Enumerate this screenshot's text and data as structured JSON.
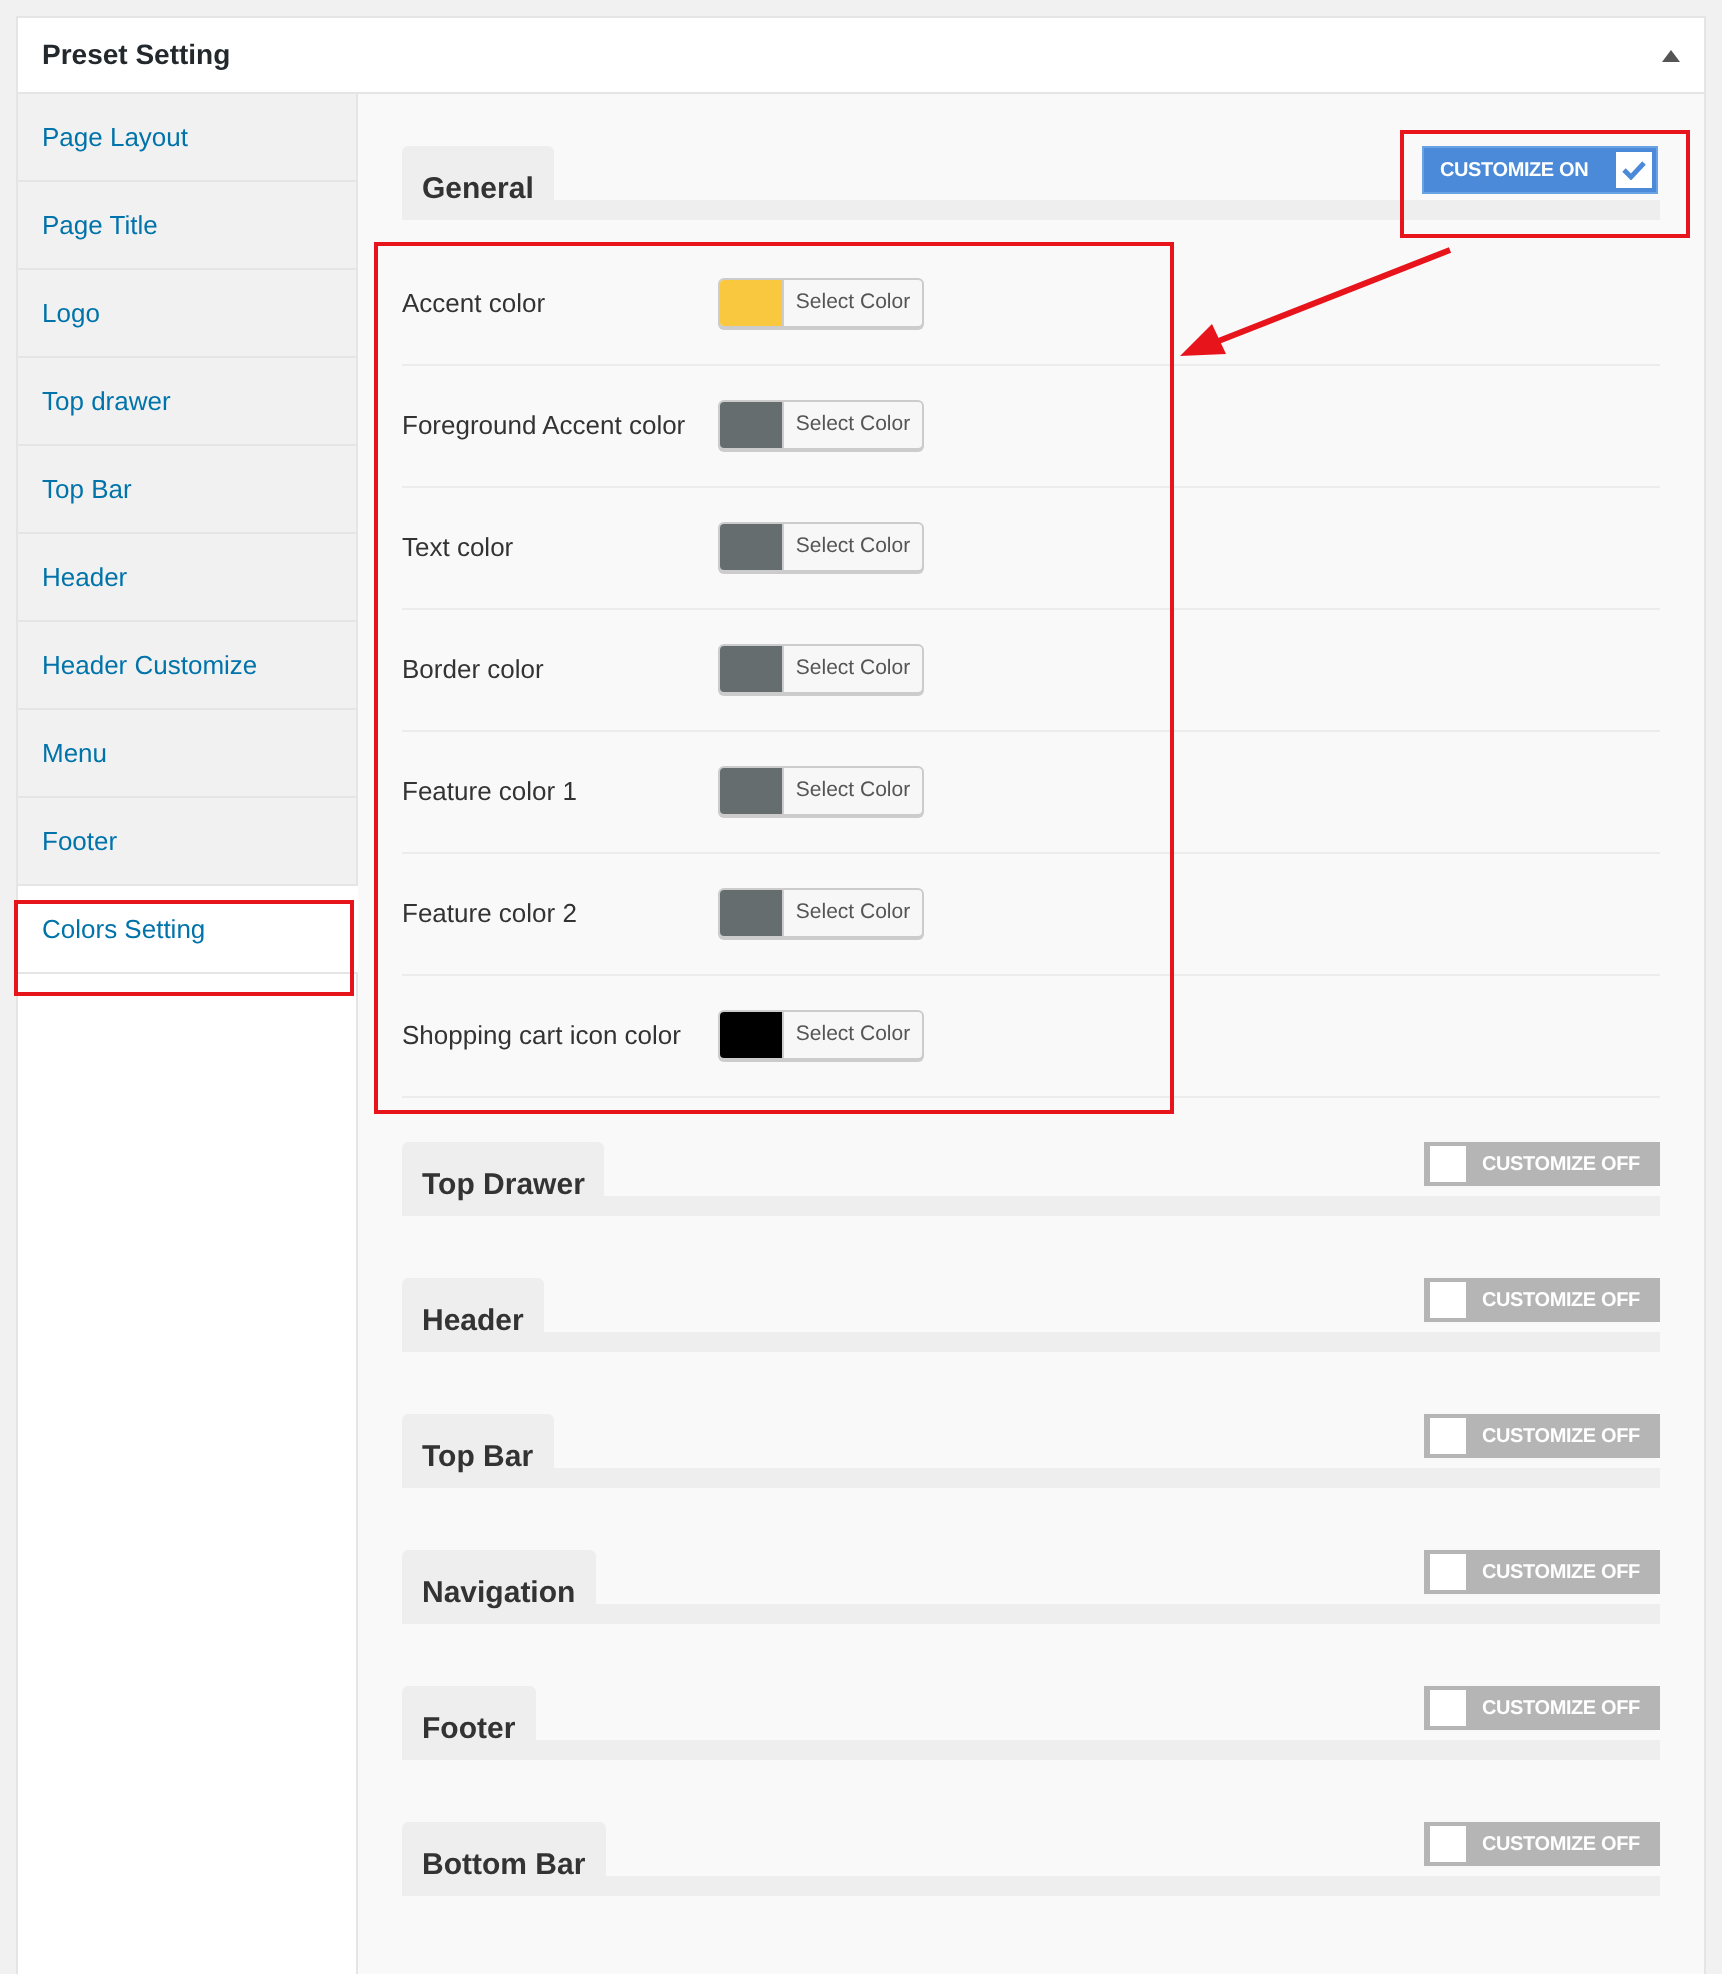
{
  "panel": {
    "title": "Preset Setting"
  },
  "sidebar": {
    "items": [
      {
        "label": "Page Layout",
        "selected": false
      },
      {
        "label": "Page Title",
        "selected": false
      },
      {
        "label": "Logo",
        "selected": false
      },
      {
        "label": "Top drawer",
        "selected": false
      },
      {
        "label": "Top Bar",
        "selected": false
      },
      {
        "label": "Header",
        "selected": false
      },
      {
        "label": "Header Customize",
        "selected": false
      },
      {
        "label": "Menu",
        "selected": false
      },
      {
        "label": "Footer",
        "selected": false
      },
      {
        "label": "Colors Setting",
        "selected": true
      }
    ]
  },
  "sections": [
    {
      "title": "General",
      "on": true,
      "toggle_label": "CUSTOMIZE ON",
      "colors": [
        {
          "label": "Accent color",
          "color": "#f9c83f",
          "button": "Select Color"
        },
        {
          "label": "Foreground Accent color",
          "color": "#656d6e",
          "button": "Select Color"
        },
        {
          "label": "Text color",
          "color": "#656d6e",
          "button": "Select Color"
        },
        {
          "label": "Border color",
          "color": "#656d6e",
          "button": "Select Color"
        },
        {
          "label": "Feature color 1",
          "color": "#656d6e",
          "button": "Select Color"
        },
        {
          "label": "Feature color 2",
          "color": "#656d6e",
          "button": "Select Color"
        },
        {
          "label": "Shopping cart icon color",
          "color": "#000000",
          "button": "Select Color"
        }
      ]
    },
    {
      "title": "Top Drawer",
      "on": false,
      "toggle_label": "CUSTOMIZE OFF"
    },
    {
      "title": "Header",
      "on": false,
      "toggle_label": "CUSTOMIZE OFF"
    },
    {
      "title": "Top Bar",
      "on": false,
      "toggle_label": "CUSTOMIZE OFF"
    },
    {
      "title": "Navigation",
      "on": false,
      "toggle_label": "CUSTOMIZE OFF"
    },
    {
      "title": "Footer",
      "on": false,
      "toggle_label": "CUSTOMIZE OFF"
    },
    {
      "title": "Bottom Bar",
      "on": false,
      "toggle_label": "CUSTOMIZE OFF"
    }
  ]
}
